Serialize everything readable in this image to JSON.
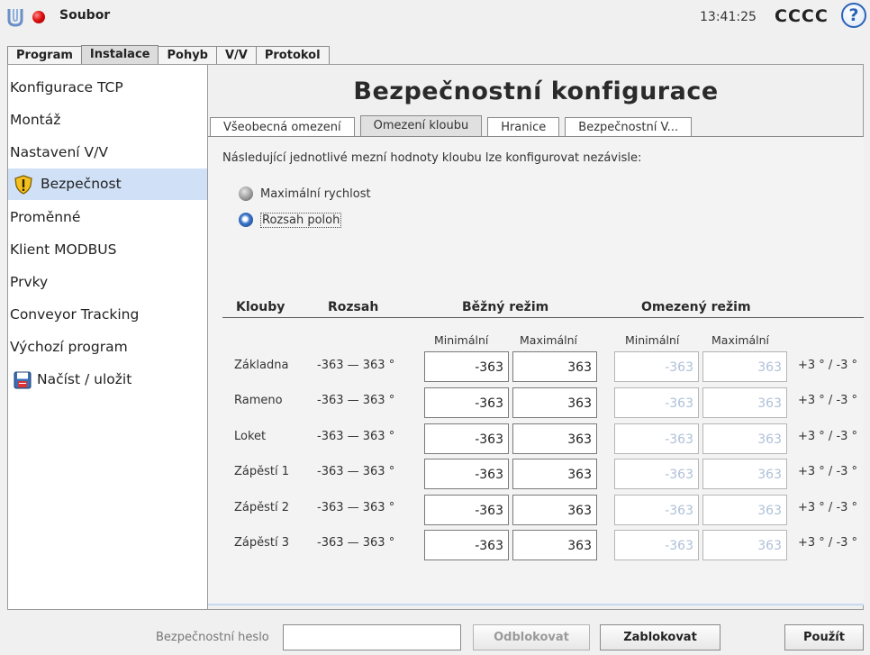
{
  "colors": {
    "accent": "#2b63b8",
    "selected_bg": "#cfe0f7",
    "status_red": "#e01010",
    "disabled_text": "#b0c0d8"
  },
  "header": {
    "file_menu": "Soubor",
    "time": "13:41:25",
    "robot_name": "CCCC",
    "help": "?"
  },
  "main_tabs": [
    {
      "label": "Program",
      "active": false
    },
    {
      "label": "Instalace",
      "active": true
    },
    {
      "label": "Pohyb",
      "active": false
    },
    {
      "label": "V/V",
      "active": false
    },
    {
      "label": "Protokol",
      "active": false
    }
  ],
  "sidebar": {
    "items": [
      {
        "label": "Konfigurace TCP"
      },
      {
        "label": "Montáž"
      },
      {
        "label": "Nastavení V/V"
      },
      {
        "label": "Bezpečnost",
        "icon": "warning-shield-icon",
        "active": true
      },
      {
        "label": "Proměnné"
      },
      {
        "label": "Klient MODBUS"
      },
      {
        "label": "Prvky"
      },
      {
        "label": "Conveyor Tracking"
      },
      {
        "label": "Výchozí program"
      },
      {
        "label": "Načíst / uložit",
        "icon": "floppy-disk-icon"
      }
    ]
  },
  "main": {
    "title": "Bezpečnostní konfigurace",
    "sub_tabs": [
      {
        "label": "Všeobecná omezení",
        "active": false
      },
      {
        "label": "Omezení kloubu",
        "active": true
      },
      {
        "label": "Hranice",
        "active": false
      },
      {
        "label": "Bezpečnostní V...",
        "active": false
      }
    ],
    "description": "Následující jednotlivé mezní hodnoty kloubu lze konfigurovat nezávisle:",
    "options": [
      {
        "label": "Maximální rychlost",
        "selected": false
      },
      {
        "label": "Rozsah poloh",
        "selected": true
      }
    ],
    "table": {
      "headers": {
        "joints": "Klouby",
        "range": "Rozsah",
        "normal": "Běžný režim",
        "reduced": "Omezený režim"
      },
      "sub_headers": {
        "min": "Minimální",
        "max": "Maximální"
      },
      "rows": [
        {
          "joint": "Základna",
          "range": "-363 — 363 °",
          "normal_min": "-363",
          "normal_max": "363",
          "reduced_min": "-363",
          "reduced_max": "363",
          "tolerance": "+3 ° / -3 °"
        },
        {
          "joint": "Rameno",
          "range": "-363 — 363 °",
          "normal_min": "-363",
          "normal_max": "363",
          "reduced_min": "-363",
          "reduced_max": "363",
          "tolerance": "+3 ° / -3 °"
        },
        {
          "joint": "Loket",
          "range": "-363 — 363 °",
          "normal_min": "-363",
          "normal_max": "363",
          "reduced_min": "-363",
          "reduced_max": "363",
          "tolerance": "+3 ° / -3 °"
        },
        {
          "joint": "Zápěstí 1",
          "range": "-363 — 363 °",
          "normal_min": "-363",
          "normal_max": "363",
          "reduced_min": "-363",
          "reduced_max": "363",
          "tolerance": "+3 ° / -3 °"
        },
        {
          "joint": "Zápěstí 2",
          "range": "-363 — 363 °",
          "normal_min": "-363",
          "normal_max": "363",
          "reduced_min": "-363",
          "reduced_max": "363",
          "tolerance": "+3 ° / -3 °"
        },
        {
          "joint": "Zápěstí 3",
          "range": "-363 — 363 °",
          "normal_min": "-363",
          "normal_max": "363",
          "reduced_min": "-363",
          "reduced_max": "363",
          "tolerance": "+3 ° / -3 °"
        }
      ]
    }
  },
  "footer": {
    "password_label": "Bezpečnostní heslo",
    "password_value": "",
    "unlock_label": "Odblokovat",
    "lock_label": "Zablokovat",
    "apply_label": "Použít"
  }
}
